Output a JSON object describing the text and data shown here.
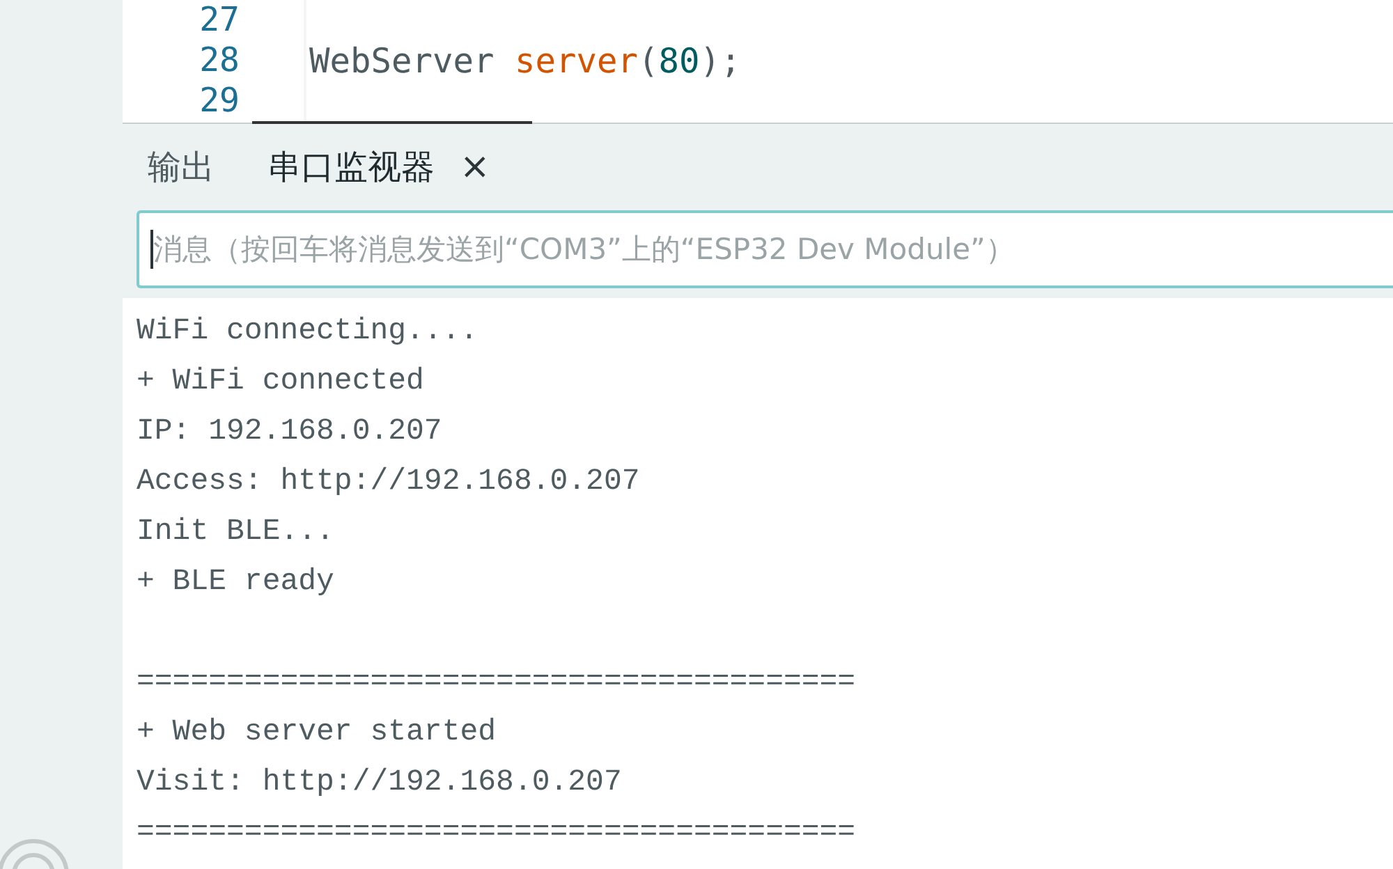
{
  "editor": {
    "lines": [
      {
        "number": "27"
      },
      {
        "number": "28",
        "tokens": [
          {
            "text": "WebServer ",
            "kind": "type"
          },
          {
            "text": "server",
            "kind": "function"
          },
          {
            "text": "(",
            "kind": "punct"
          },
          {
            "text": "80",
            "kind": "number"
          },
          {
            "text": ");",
            "kind": "punct"
          }
        ]
      },
      {
        "number": "29"
      }
    ]
  },
  "panel": {
    "tabs": [
      {
        "label": "输出",
        "selected": false
      },
      {
        "label": "串口监视器",
        "selected": true,
        "close": "×"
      }
    ],
    "message_field": {
      "placeholder": "消息（按回车将消息发送到“COM3”上的“ESP32 Dev Module”）"
    },
    "output": [
      {
        "kind": "text",
        "text": "WiFi connecting...."
      },
      {
        "kind": "text",
        "text": "+ WiFi connected"
      },
      {
        "kind": "text",
        "text": "IP: 192.168.0.207"
      },
      {
        "kind": "text",
        "text": "Access: http://192.168.0.207"
      },
      {
        "kind": "text",
        "text": "Init BLE..."
      },
      {
        "kind": "text",
        "text": "+ BLE ready"
      },
      {
        "kind": "blank"
      },
      {
        "kind": "text",
        "text": "========================================"
      },
      {
        "kind": "text",
        "text": "+ Web server started"
      },
      {
        "kind": "text",
        "text": "Visit: http://192.168.0.207"
      },
      {
        "kind": "text",
        "text": "========================================"
      }
    ]
  }
}
